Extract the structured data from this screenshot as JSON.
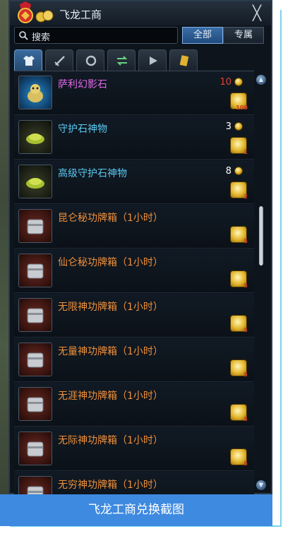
{
  "window": {
    "title": "飞龙工商",
    "close_glyph": "╳"
  },
  "search": {
    "placeholder": "搜索",
    "text": "搜索"
  },
  "filter": {
    "all_label": "全部",
    "exclusive_label": "专属"
  },
  "tabs": [
    {
      "icon": "shirt-icon",
      "active": true
    },
    {
      "icon": "sword-icon",
      "active": false
    },
    {
      "icon": "ring-icon",
      "active": false
    },
    {
      "icon": "swap-arrows-icon",
      "active": false
    },
    {
      "icon": "horn-icon",
      "active": false
    },
    {
      "icon": "ticket-icon",
      "active": false
    }
  ],
  "items": [
    {
      "name": "萨利幻影石",
      "color": "#e068e8",
      "price": "10",
      "price_color": "#e84030",
      "coin_badge": "100",
      "thumb": "blue"
    },
    {
      "name": "守护石神物",
      "color": "#5ac8f0",
      "price": "3",
      "price_color": "#ffffff",
      "coin_badge": "1",
      "thumb": "dark"
    },
    {
      "name": "高级守护石神物",
      "color": "#5ac8f0",
      "price": "8",
      "price_color": "#ffffff",
      "coin_badge": "2",
      "thumb": "dark"
    },
    {
      "name": "昆仑秘功牌箱（1小时）",
      "color": "#f0903a",
      "price": "",
      "price_color": "#ffffff",
      "coin_badge": "5",
      "thumb": "red"
    },
    {
      "name": "仙仑秘功牌箱（1小时）",
      "color": "#f0903a",
      "price": "",
      "price_color": "#ffffff",
      "coin_badge": "5",
      "thumb": "red"
    },
    {
      "name": "无限神功牌箱（1小时）",
      "color": "#f0903a",
      "price": "",
      "price_color": "#ffffff",
      "coin_badge": "5",
      "thumb": "red"
    },
    {
      "name": "无量神功牌箱（1小时）",
      "color": "#f0903a",
      "price": "",
      "price_color": "#ffffff",
      "coin_badge": "5",
      "thumb": "red"
    },
    {
      "name": "无涯神功牌箱（1小时）",
      "color": "#f0903a",
      "price": "",
      "price_color": "#ffffff",
      "coin_badge": "5",
      "thumb": "red"
    },
    {
      "name": "无际神功牌箱（1小时）",
      "color": "#f0903a",
      "price": "",
      "price_color": "#ffffff",
      "coin_badge": "5",
      "thumb": "red"
    },
    {
      "name": "无穷神功牌箱（1小时）",
      "color": "#f0903a",
      "price": "",
      "price_color": "#ffffff",
      "coin_badge": "5",
      "thumb": "red"
    }
  ],
  "caption": "飞龙工商兑换截图",
  "colors": {
    "accent": "#3e8ae0",
    "frame": "#7cd4e8"
  }
}
